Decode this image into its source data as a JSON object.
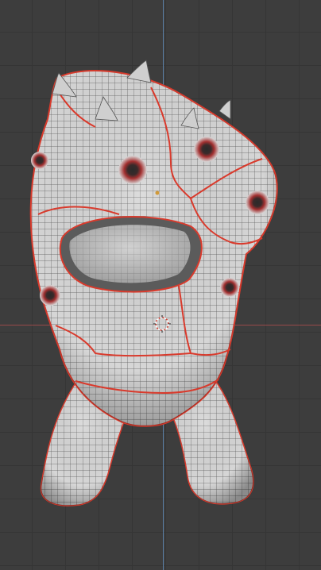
{
  "viewport": {
    "background_color": "#3d3d3d",
    "grid_color": "#353535",
    "x_axis_color": "#9c4a4a",
    "y_axis_color": "#5f88b3"
  },
  "model": {
    "icon": "creature-mesh",
    "surface_color": "#d8d8d8",
    "wire_color": "#4b4b4b",
    "seam_color": "#d93a2c",
    "eye_color": "#9a2b2b"
  },
  "cursor": {
    "icon": "3d-cursor-icon"
  }
}
